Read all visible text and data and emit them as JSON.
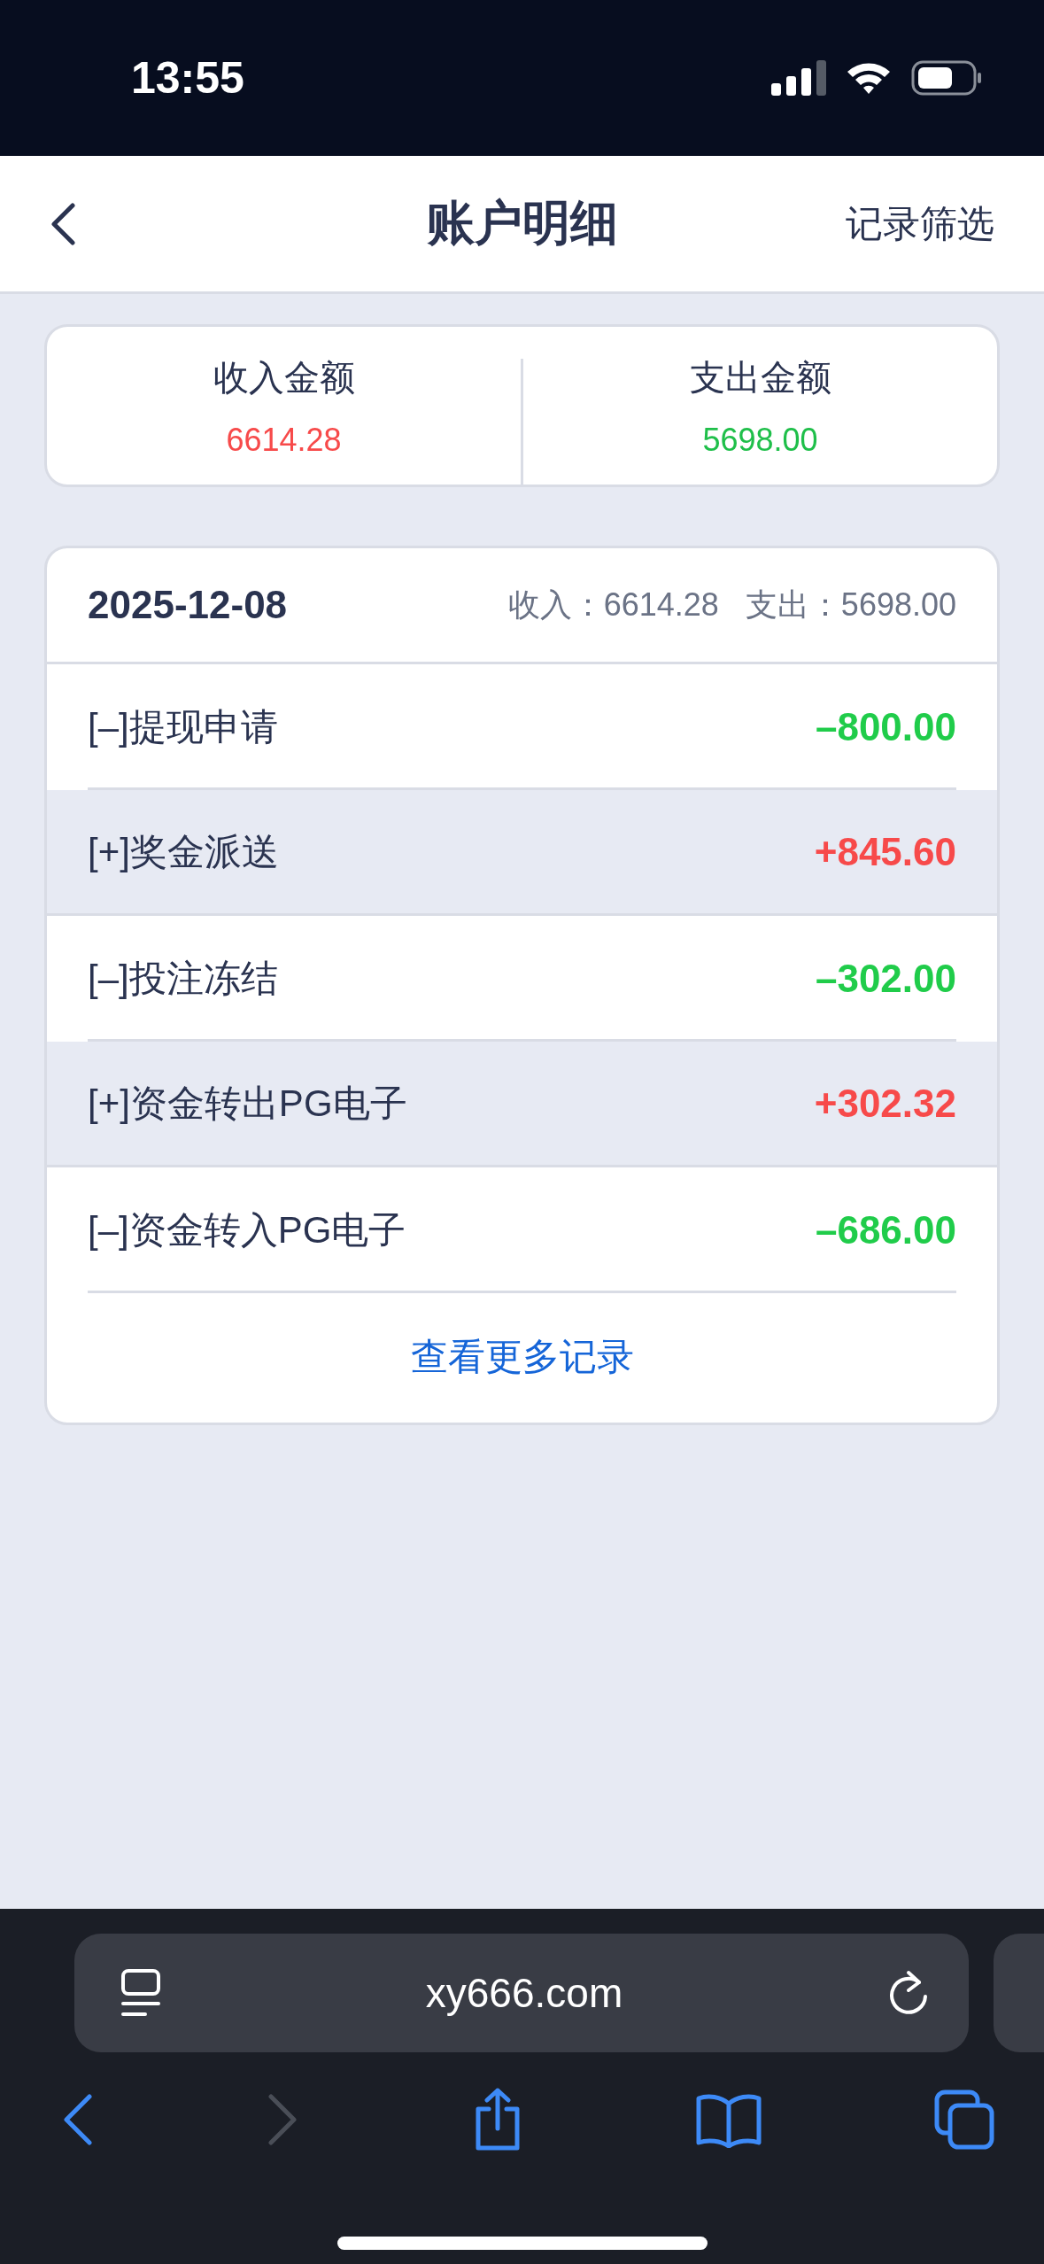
{
  "status_bar": {
    "time": "13:55"
  },
  "nav": {
    "title": "账户明细",
    "action": "记录筛选"
  },
  "summary": [
    {
      "label": "收入金额",
      "value": "6614.28",
      "kind": "income"
    },
    {
      "label": "支出金额",
      "value": "5698.00",
      "kind": "expense"
    }
  ],
  "day": {
    "date": "2025-12-08",
    "income_label": "收入：",
    "income": "6614.28",
    "expense_label": "支出：",
    "expense": "5698.00"
  },
  "records": [
    {
      "label": "[–]提现申请",
      "amount": "–800.00",
      "kind": "expense"
    },
    {
      "label": "[+]奖金派送",
      "amount": "+845.60",
      "kind": "income"
    },
    {
      "label": "[–]投注冻结",
      "amount": "–302.00",
      "kind": "expense"
    },
    {
      "label": "[+]资金转出PG电子",
      "amount": "+302.32",
      "kind": "income"
    },
    {
      "label": "[–]资金转入PG电子",
      "amount": "–686.00",
      "kind": "expense"
    }
  ],
  "more_link": "查看更多记录",
  "browser": {
    "url": "xy666.com",
    "forward_disabled": true
  }
}
